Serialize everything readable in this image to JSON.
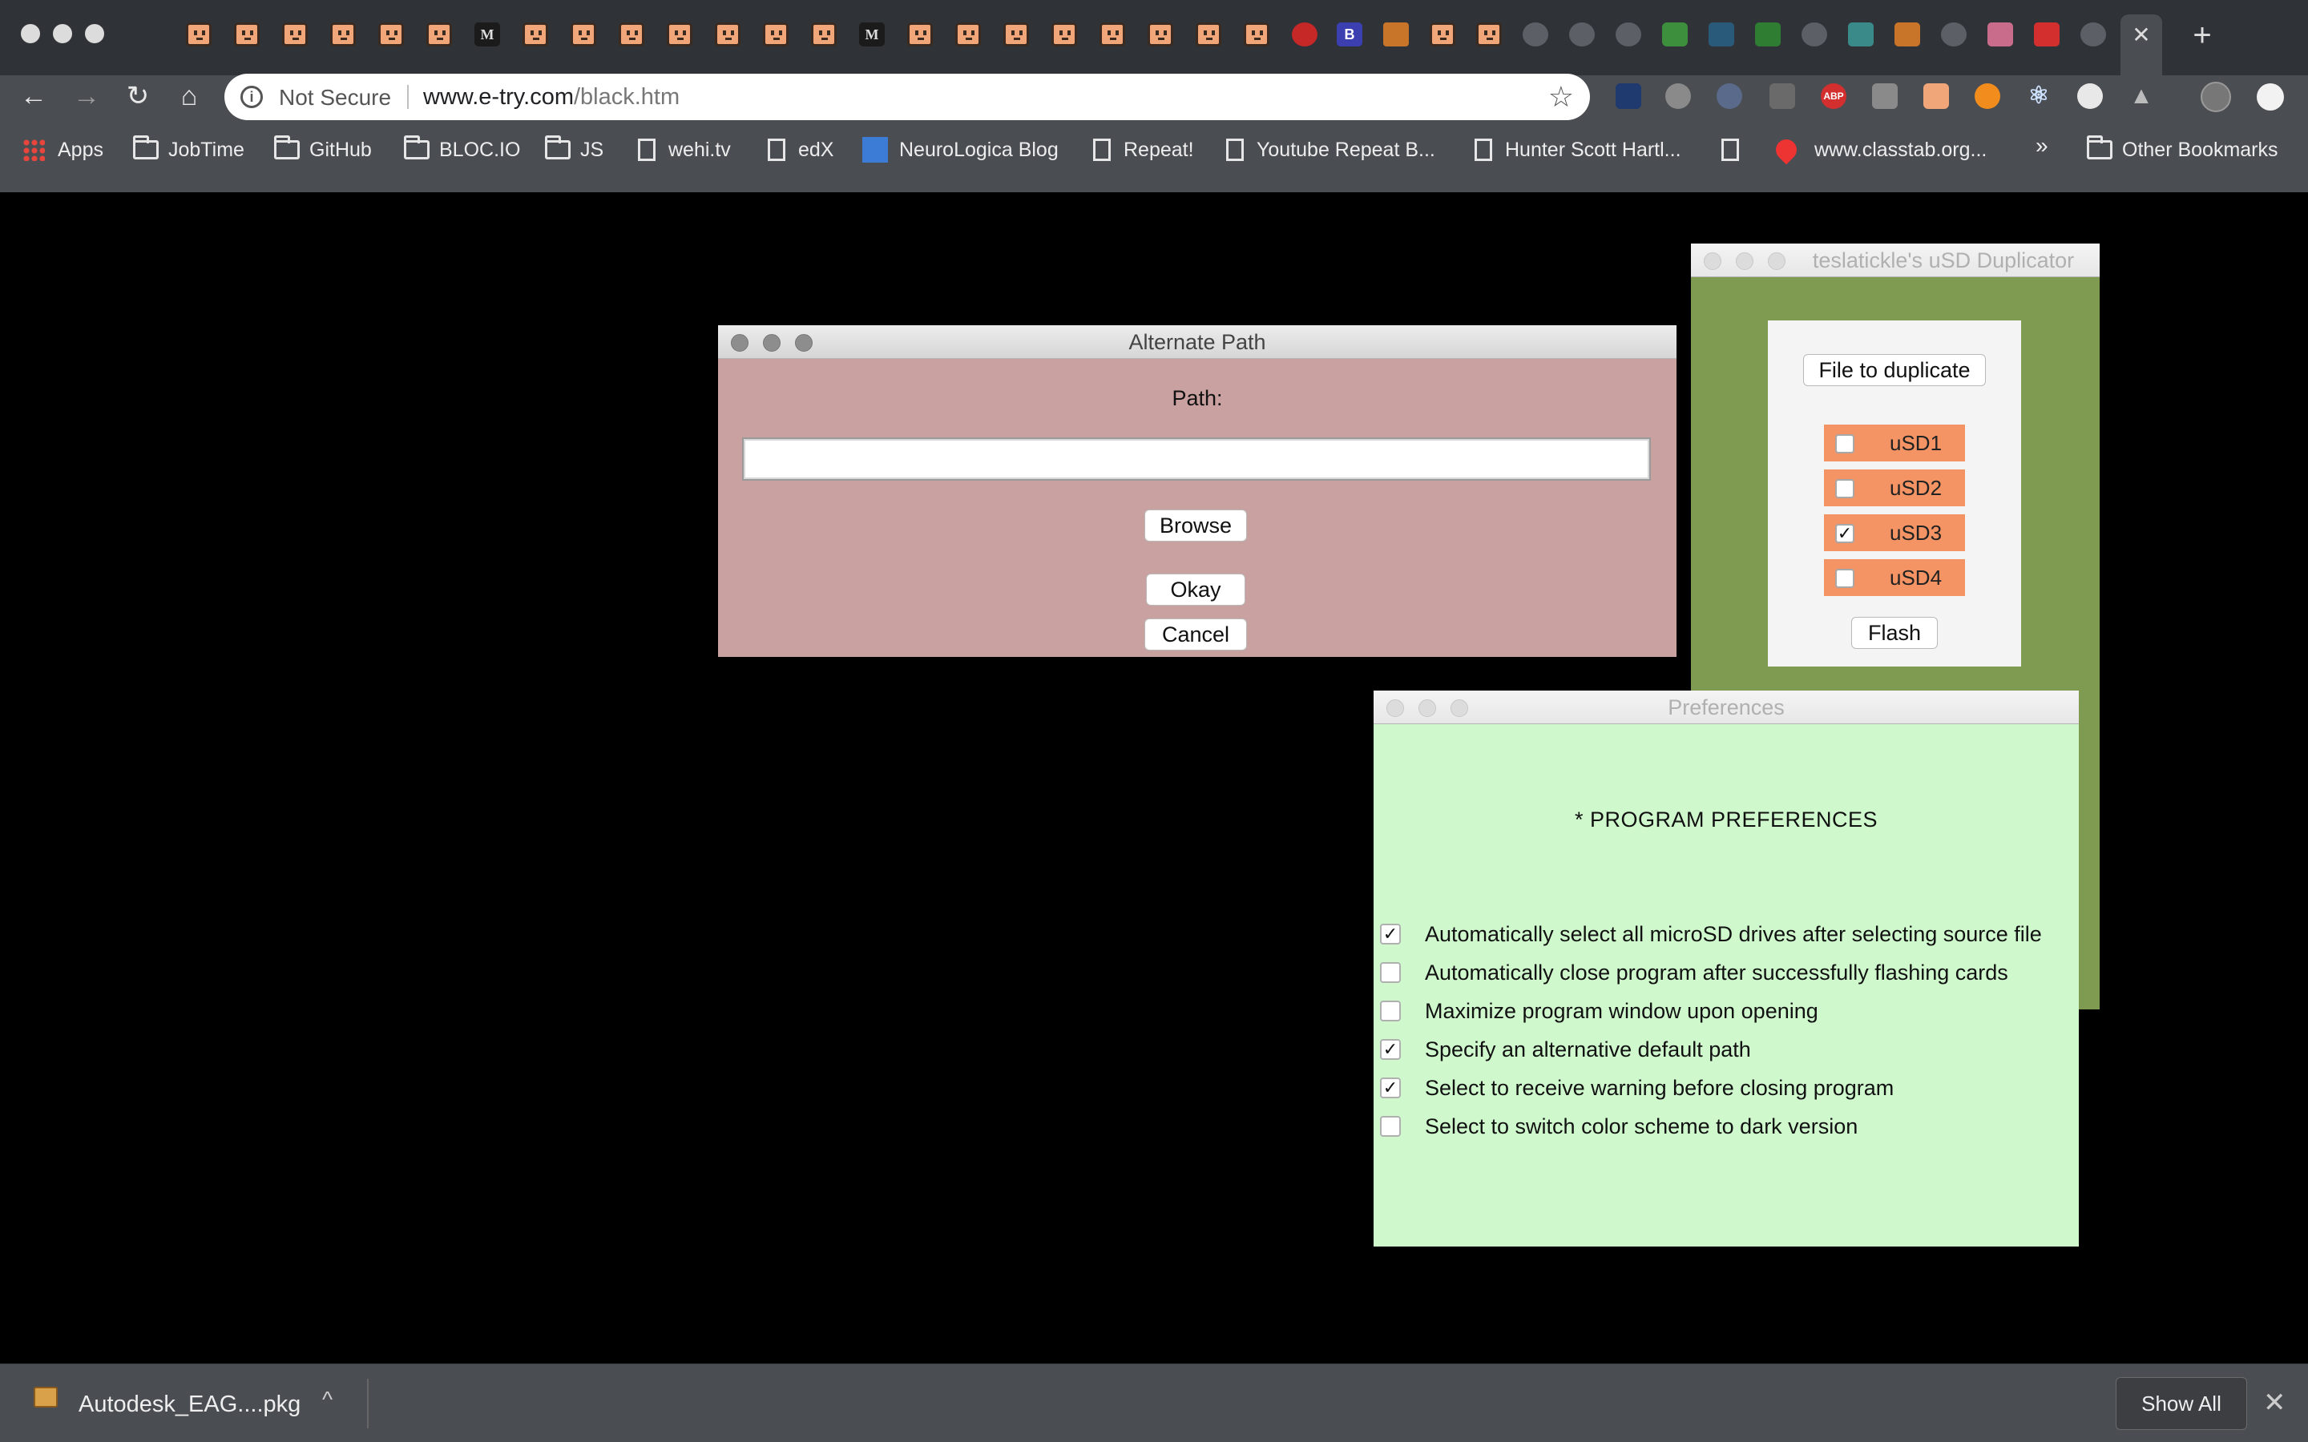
{
  "browser": {
    "tab_glyphs": [
      "M",
      "M",
      "B"
    ],
    "active_tab_close": "✕",
    "new_tab": "+",
    "address": {
      "security_label": "Not Secure",
      "host": "www.e-try.com",
      "path": "/black.htm"
    },
    "extensions": [
      "ABP"
    ],
    "bookmarks": [
      {
        "label": "Apps",
        "icon": "apps-grid-icon"
      },
      {
        "label": "JobTime",
        "icon": "folder-icon"
      },
      {
        "label": "GitHub",
        "icon": "folder-icon"
      },
      {
        "label": "BLOC.IO",
        "icon": "folder-icon"
      },
      {
        "label": "JS",
        "icon": "folder-icon"
      },
      {
        "label": "wehi.tv",
        "icon": "page-icon"
      },
      {
        "label": "edX",
        "icon": "page-icon"
      },
      {
        "label": "NeuroLogica Blog",
        "icon": "neurologica-icon"
      },
      {
        "label": "Repeat!",
        "icon": "page-icon"
      },
      {
        "label": "Youtube Repeat B...",
        "icon": "page-icon"
      },
      {
        "label": "Hunter Scott Hartl...",
        "icon": "page-icon"
      },
      {
        "label": "www.classtab.org...",
        "icon": "heart-icon"
      },
      {
        "label": "Other Bookmarks",
        "icon": "folder-icon"
      }
    ],
    "overflow_chevron": "»"
  },
  "alternate_path": {
    "title": "Alternate Path",
    "path_label": "Path:",
    "path_value": "",
    "browse": "Browse",
    "okay": "Okay",
    "cancel": "Cancel"
  },
  "duplicator": {
    "title": "teslatickle's uSD Duplicator",
    "file_button": "File to duplicate",
    "drives": [
      {
        "label": "uSD1",
        "checked": false
      },
      {
        "label": "uSD2",
        "checked": false
      },
      {
        "label": "uSD3",
        "checked": true
      },
      {
        "label": "uSD4",
        "checked": false
      }
    ],
    "flash": "Flash"
  },
  "preferences": {
    "title": "Preferences",
    "heading": "* PROGRAM PREFERENCES",
    "options": [
      {
        "label": "Automatically select all microSD drives after selecting source file",
        "checked": true
      },
      {
        "label": "Automatically close program after successfully flashing cards",
        "checked": false
      },
      {
        "label": "Maximize program window upon opening",
        "checked": false
      },
      {
        "label": "Specify an alternative default path",
        "checked": true
      },
      {
        "label": "Select to receive warning before closing program",
        "checked": true
      },
      {
        "label": "Select to switch color scheme to dark version",
        "checked": false
      }
    ]
  },
  "download_shelf": {
    "file_name": "Autodesk_EAG....pkg",
    "caret": "^",
    "show_all": "Show All",
    "close": "✕"
  },
  "colors": {
    "alt_bg": "#c9a1a0",
    "dup_bg": "#7f9b52",
    "usd_row": "#f49465",
    "pref_bg": "#cff8cd"
  }
}
